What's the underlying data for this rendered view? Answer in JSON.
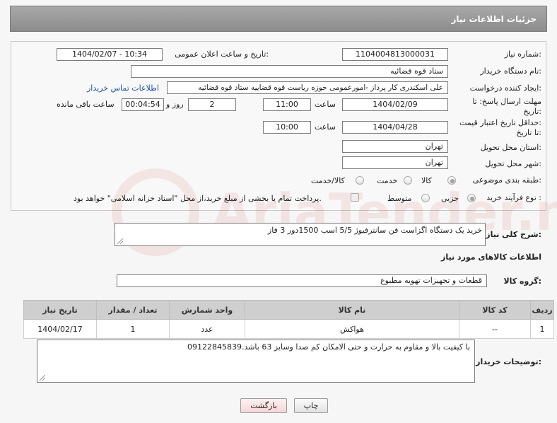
{
  "header": {
    "title": "جزئیات اطلاعات نیاز"
  },
  "form": {
    "need_number_label": "شماره نیاز:",
    "need_number": "1104004813000031",
    "announce_label": "تاریخ و ساعت اعلان عمومی:",
    "announce_value": "1404/02/07 - 10:34",
    "buyer_org_label": "نام دستگاه خریدار:",
    "buyer_org": "ستاد قوه قضائیه",
    "creator_label": "ایجاد کننده درخواست:",
    "creator": "علی اسکندری کار پرداز -امورعمومی حوزه ریاست قوه قضاییه ستاد قوه قضائیه",
    "contact_link": "اطلاعات تماس خریدار",
    "deadline_label_1": "مهلت ارسال پاسخ: تا",
    "deadline_label_2": "تاریخ:",
    "deadline_date": "1404/02/09",
    "time_label": "ساعت",
    "deadline_time": "11:00",
    "days_value": "2",
    "days_label": "روز و",
    "remaining_time": "00:04:54",
    "remaining_label": "ساعت باقی مانده",
    "price_label_1": "حداقل تاریخ اعتبار قیمت:",
    "price_label_2": "تا تاریخ:",
    "price_date": "1404/04/28",
    "price_time": "10:00",
    "province_label": "استان محل تحویل:",
    "province": "تهران",
    "city_label": "شهر محل تحویل:",
    "city": "تهران",
    "category_label": "طبقه بندی موضوعی:",
    "category_options": [
      "کالا",
      "خدمت",
      "کالا/خدمت"
    ],
    "process_label": "نوع فرآیند خرید :",
    "process_options": [
      "جزیی",
      "متوسط"
    ],
    "payment_note": "پرداخت تمام یا بخشی از مبلغ خرید،از محل \"اسناد خزانه اسلامی\" خواهد بود."
  },
  "description": {
    "label": "شرح کلی نیاز:",
    "text": "خرید یک دستگاه اگزاست فن سانترفیوژ 5/5 اسب 1500دور 3 فاز"
  },
  "goods": {
    "section_title": "اطلاعات کالاهای مورد نیاز",
    "group_label": "گروه کالا:",
    "group_value": "قطعات و تجهیزات تهویه مطبوع",
    "columns": [
      "ردیف",
      "کد کالا",
      "نام کالا",
      "واحد شمارش",
      "تعداد / مقدار",
      "تاریخ نیاز"
    ],
    "rows": [
      {
        "row": "1",
        "code": "--",
        "name": "هواکش",
        "unit": "عدد",
        "qty": "1",
        "date": "1404/02/17"
      }
    ]
  },
  "buyer_notes": {
    "label": "توضیحات خریدار:",
    "text": "با کیفیت بالا و مقاوم به حرارت و حتی الامکان کم صدا وسایز 63 باشد.09122845839"
  },
  "buttons": {
    "print": "چاپ",
    "back": "بازگشت"
  },
  "watermark": {
    "text": "AriaTender.net"
  },
  "colors": {
    "header": "#999999",
    "link": "#1a4fa0",
    "back_button": "#fde4e4"
  }
}
